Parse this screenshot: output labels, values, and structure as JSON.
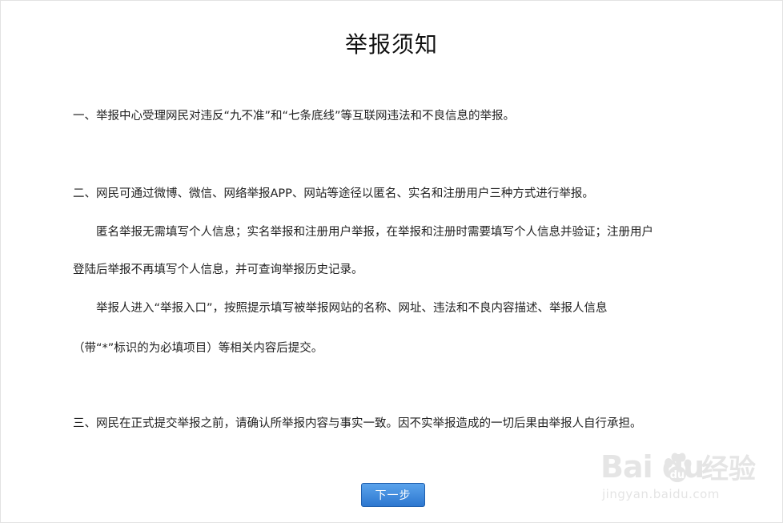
{
  "notice": {
    "title": "举报须知",
    "lines": [
      "一、举报中心受理网民对违反“九不准”和“七条底线”等互联网违法和不良信息的举报。",
      "二、网民可通过微博、微信、网络举报APP、网站等途径以匿名、实名和注册用户三种方式进行举报。",
      "匿名举报无需填写个人信息；实名举报和注册用户举报，在举报和注册时需要填写个人信息并验证；注册用户",
      "登陆后举报不再填写个人信息，并可查询举报历史记录。",
      "举报人进入“举报入口”，按照提示填写被举报网站的名称、网址、违法和不良内容描述、举报人信息",
      "（带“*”标识的为必填项目）等相关内容后提交。",
      "三、网民在正式提交举报之前，请确认所举报内容与事实一致。因不实举报造成的一切后果由举报人自行承担。"
    ],
    "next_label": "下一步"
  },
  "watermark": {
    "brand": "Bai  du",
    "brand_cn": "经验",
    "url": "jingyan.baidu.com"
  },
  "colors": {
    "button_top": "#5aa3ec",
    "button_bottom": "#2d77cf",
    "text": "#222222"
  }
}
